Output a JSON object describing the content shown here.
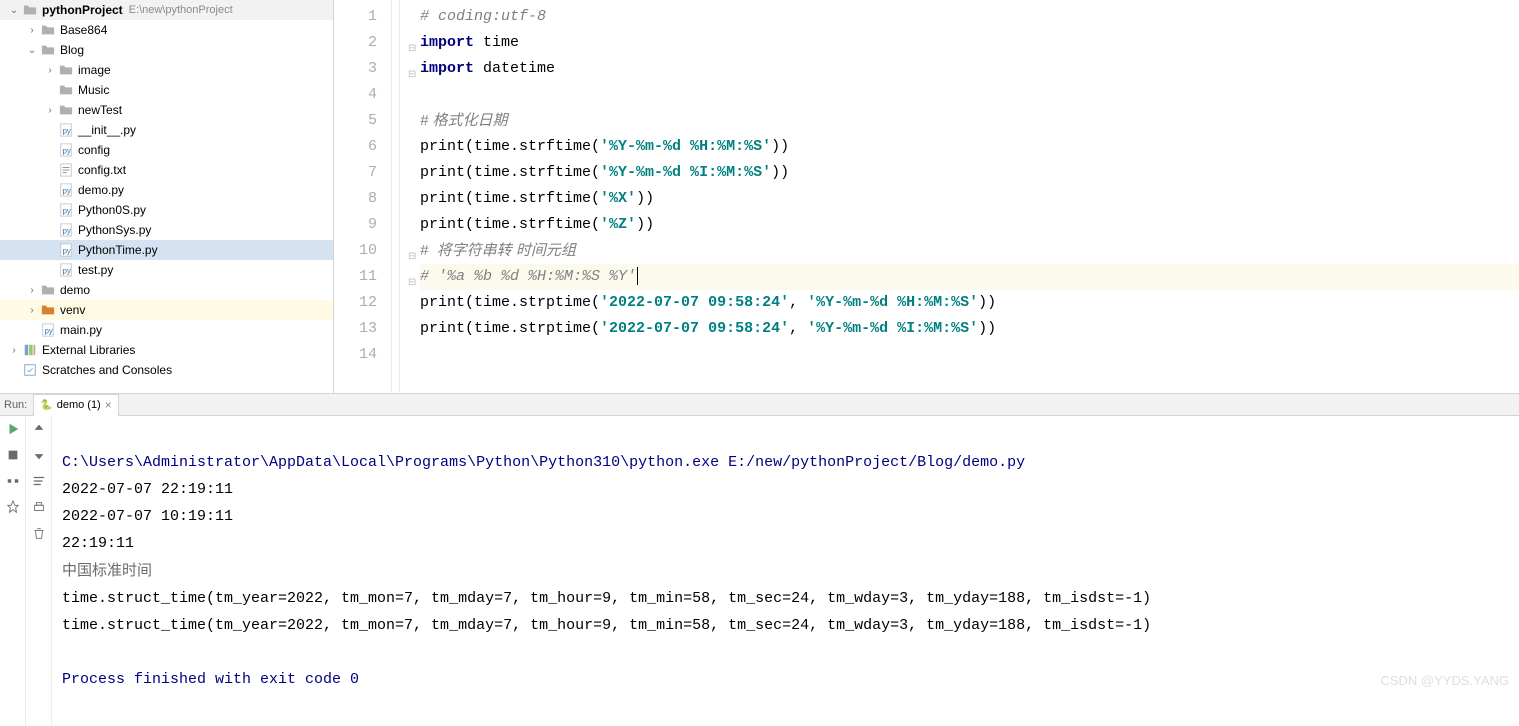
{
  "project_tree": {
    "root": {
      "name": "pythonProject",
      "path": "E:\\new\\pythonProject"
    },
    "nodes": [
      {
        "indent": 0,
        "arrow": "down",
        "icon": "folder",
        "label": "pythonProject",
        "bold": true,
        "meta": "E:\\new\\pythonProject"
      },
      {
        "indent": 1,
        "arrow": "right",
        "icon": "folder",
        "label": "Base864"
      },
      {
        "indent": 1,
        "arrow": "down",
        "icon": "folder",
        "label": "Blog"
      },
      {
        "indent": 2,
        "arrow": "right",
        "icon": "folder",
        "label": "image"
      },
      {
        "indent": 2,
        "arrow": "none",
        "icon": "folder",
        "label": "Music"
      },
      {
        "indent": 2,
        "arrow": "right",
        "icon": "folder",
        "label": "newTest"
      },
      {
        "indent": 2,
        "arrow": "none",
        "icon": "py",
        "label": "__init__.py"
      },
      {
        "indent": 2,
        "arrow": "none",
        "icon": "py",
        "label": "config"
      },
      {
        "indent": 2,
        "arrow": "none",
        "icon": "txt",
        "label": "config.txt"
      },
      {
        "indent": 2,
        "arrow": "none",
        "icon": "py",
        "label": "demo.py"
      },
      {
        "indent": 2,
        "arrow": "none",
        "icon": "py",
        "label": "Python0S.py"
      },
      {
        "indent": 2,
        "arrow": "none",
        "icon": "py",
        "label": "PythonSys.py"
      },
      {
        "indent": 2,
        "arrow": "none",
        "icon": "py",
        "label": "PythonTime.py",
        "selected": true
      },
      {
        "indent": 2,
        "arrow": "none",
        "icon": "py",
        "label": "test.py"
      },
      {
        "indent": 1,
        "arrow": "right",
        "icon": "folder",
        "label": "demo"
      },
      {
        "indent": 1,
        "arrow": "right",
        "icon": "venv",
        "label": "venv",
        "highlight": true
      },
      {
        "indent": 1,
        "arrow": "none",
        "icon": "py",
        "label": "main.py"
      },
      {
        "indent": 0,
        "arrow": "right",
        "icon": "lib",
        "label": "External Libraries"
      },
      {
        "indent": 0,
        "arrow": "none",
        "icon": "scratch",
        "label": "Scratches and Consoles"
      }
    ]
  },
  "editor": {
    "line_count": 14,
    "highlight_line": 11,
    "lines": {
      "l1": "# coding:utf-8",
      "l2a": "import",
      "l2b": " time",
      "l3a": "import",
      "l3b": " datetime",
      "l5": "# 格式化日期",
      "l6a": "print",
      "l6b": "(time.strftime(",
      "l6c": "'%Y-%m-%d %H:%M:%S'",
      "l6d": "))",
      "l7a": "print",
      "l7b": "(time.strftime(",
      "l7c": "'%Y-%m-%d %I:%M:%S'",
      "l7d": "))",
      "l8a": "print",
      "l8b": "(time.strftime(",
      "l8c": "'%X'",
      "l8d": "))",
      "l9a": "print",
      "l9b": "(time.strftime(",
      "l9c": "'%Z'",
      "l9d": "))",
      "l10": "#  将字符串转 时间元组",
      "l11": "# '%a %b %d %H:%M:%S %Y'",
      "l12a": "print",
      "l12b": "(time.strptime(",
      "l12c": "'2022-07-07 09:58:24'",
      "l12d": ", ",
      "l12e": "'%Y-%m-%d %H:%M:%S'",
      "l12f": "))",
      "l13a": "print",
      "l13b": "(time.strptime(",
      "l13c": "'2022-07-07 09:58:24'",
      "l13d": ", ",
      "l13e": "'%Y-%m-%d %I:%M:%S'",
      "l13f": "))"
    }
  },
  "run": {
    "label": "Run:",
    "tab_name": "demo (1)",
    "output": {
      "path": "C:\\Users\\Administrator\\AppData\\Local\\Programs\\Python\\Python310\\python.exe E:/new/pythonProject/Blog/demo.py",
      "o1": "2022-07-07 22:19:11",
      "o2": "2022-07-07 10:19:11",
      "o3": "22:19:11",
      "o4": "中国标准时间",
      "o5": "time.struct_time(tm_year=2022, tm_mon=7, tm_mday=7, tm_hour=9, tm_min=58, tm_sec=24, tm_wday=3, tm_yday=188, tm_isdst=-1)",
      "o6": "time.struct_time(tm_year=2022, tm_mon=7, tm_mday=7, tm_hour=9, tm_min=58, tm_sec=24, tm_wday=3, tm_yday=188, tm_isdst=-1)",
      "exit": "Process finished with exit code 0"
    }
  },
  "watermark": "CSDN @YYDS.YANG"
}
